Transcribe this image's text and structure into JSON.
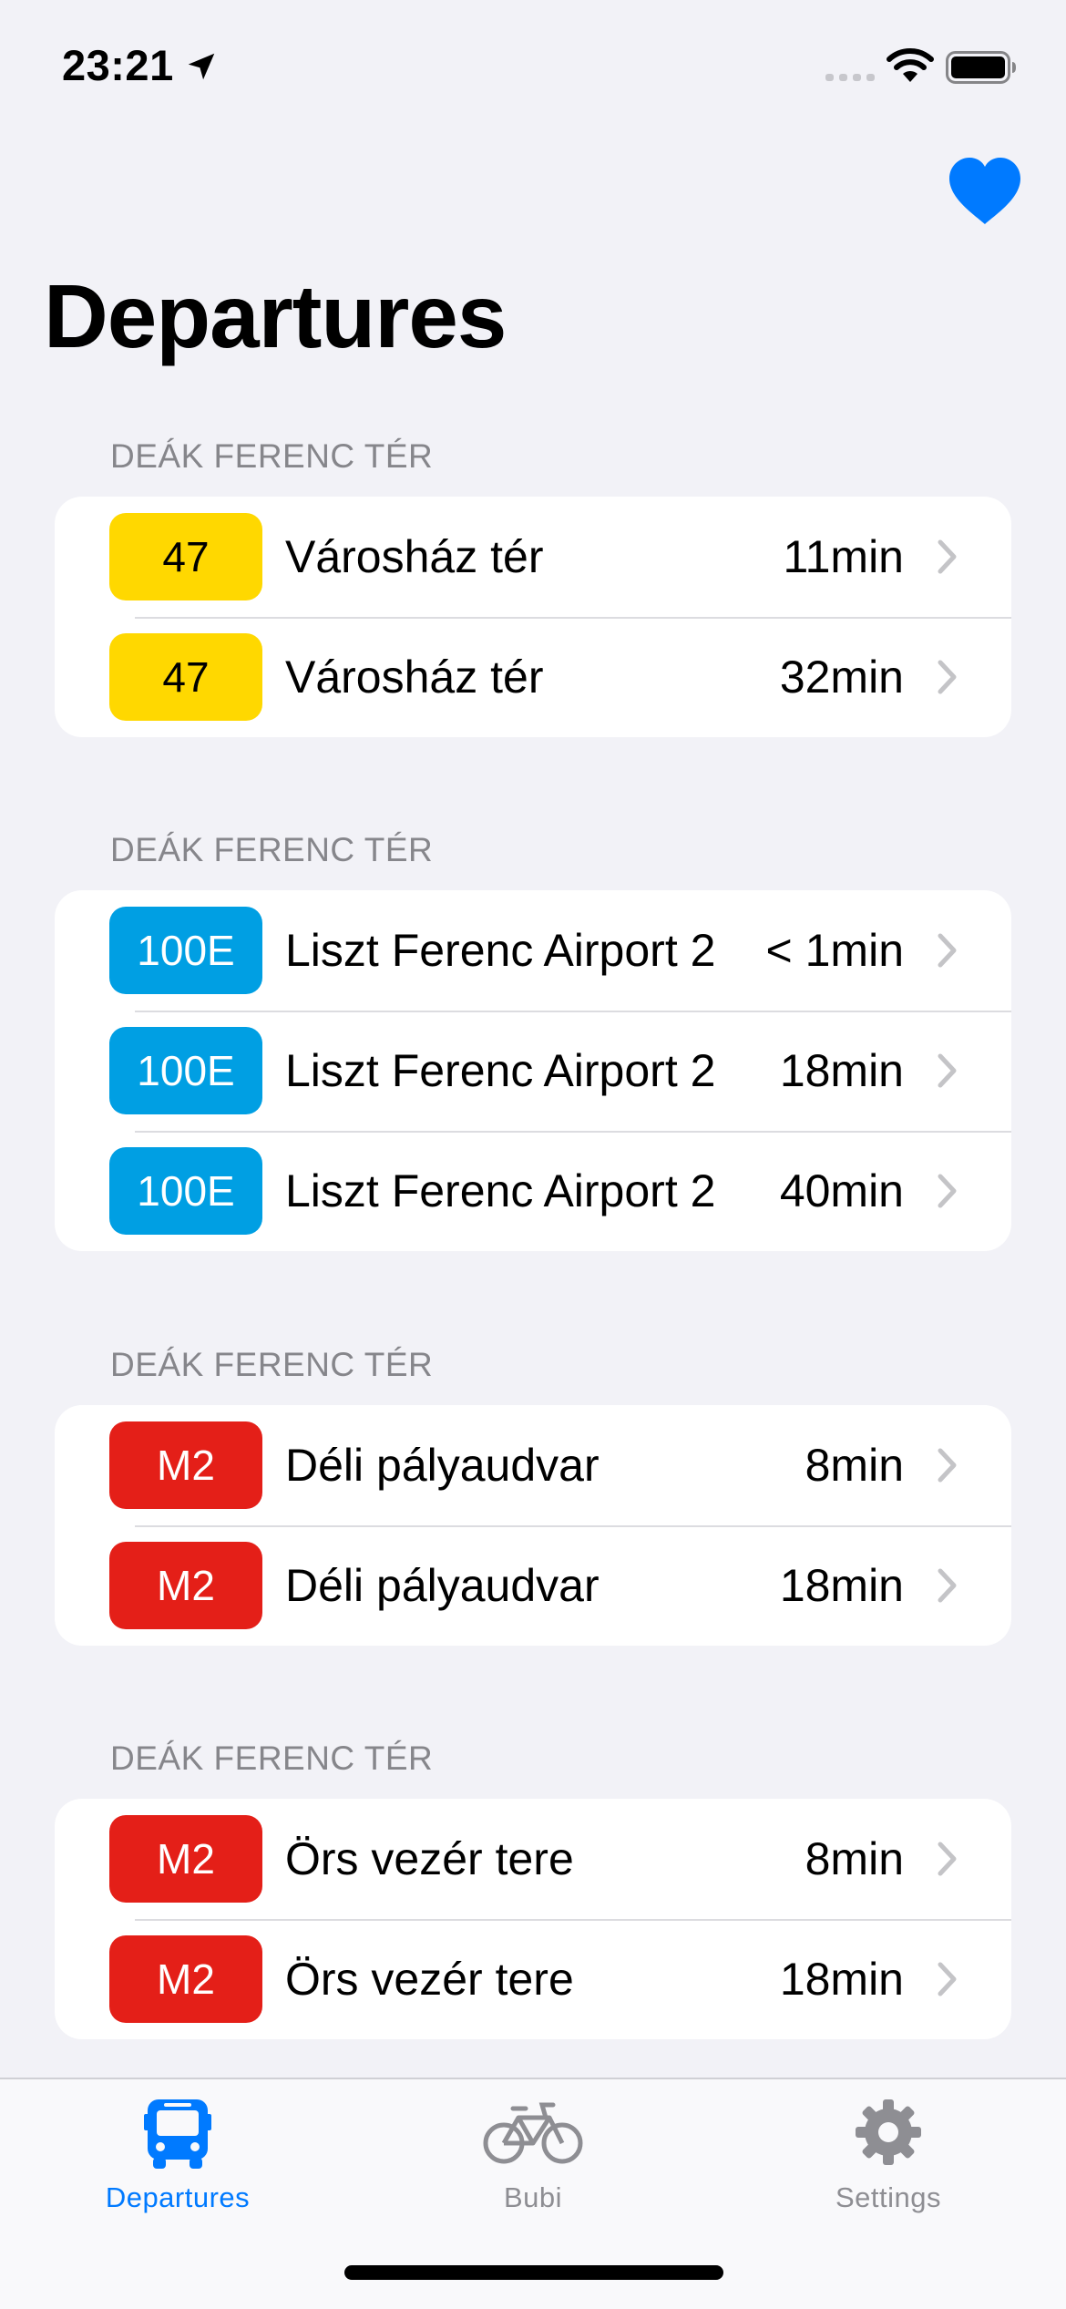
{
  "status_bar": {
    "time": "23:21"
  },
  "header": {
    "title": "Departures"
  },
  "sections": [
    {
      "stop": "DEÁK FERENC TÉR",
      "departures": [
        {
          "route": "47",
          "badge_color": "#ffd800",
          "text_color": "#000000",
          "destination": "Városház tér",
          "eta": "11min"
        },
        {
          "route": "47",
          "badge_color": "#ffd800",
          "text_color": "#000000",
          "destination": "Városház tér",
          "eta": "32min"
        }
      ]
    },
    {
      "stop": "DEÁK FERENC TÉR",
      "departures": [
        {
          "route": "100E",
          "badge_color": "#009fe3",
          "text_color": "#ffffff",
          "destination": "Liszt Ferenc Airport 2",
          "eta": "< 1min"
        },
        {
          "route": "100E",
          "badge_color": "#009fe3",
          "text_color": "#ffffff",
          "destination": "Liszt Ferenc Airport 2",
          "eta": "18min"
        },
        {
          "route": "100E",
          "badge_color": "#009fe3",
          "text_color": "#ffffff",
          "destination": "Liszt Ferenc Airport 2",
          "eta": "40min"
        }
      ]
    },
    {
      "stop": "DEÁK FERENC TÉR",
      "departures": [
        {
          "route": "M2",
          "badge_color": "#e41f18",
          "text_color": "#ffffff",
          "destination": "Déli pályaudvar",
          "eta": "8min"
        },
        {
          "route": "M2",
          "badge_color": "#e41f18",
          "text_color": "#ffffff",
          "destination": "Déli pályaudvar",
          "eta": "18min"
        }
      ]
    },
    {
      "stop": "DEÁK FERENC TÉR",
      "departures": [
        {
          "route": "M2",
          "badge_color": "#e41f18",
          "text_color": "#ffffff",
          "destination": "Örs vezér tere",
          "eta": "8min"
        },
        {
          "route": "M2",
          "badge_color": "#e41f18",
          "text_color": "#ffffff",
          "destination": "Örs vezér tere",
          "eta": "18min"
        }
      ]
    }
  ],
  "tab_bar": {
    "tabs": [
      {
        "label": "Departures",
        "icon": "bus-icon",
        "active": true
      },
      {
        "label": "Bubi",
        "icon": "bicycle-icon",
        "active": false
      },
      {
        "label": "Settings",
        "icon": "gear-icon",
        "active": false
      }
    ]
  },
  "colors": {
    "accent": "#007aff",
    "inactive": "#8e8e93",
    "background": "#f2f2f7",
    "card": "#ffffff"
  }
}
